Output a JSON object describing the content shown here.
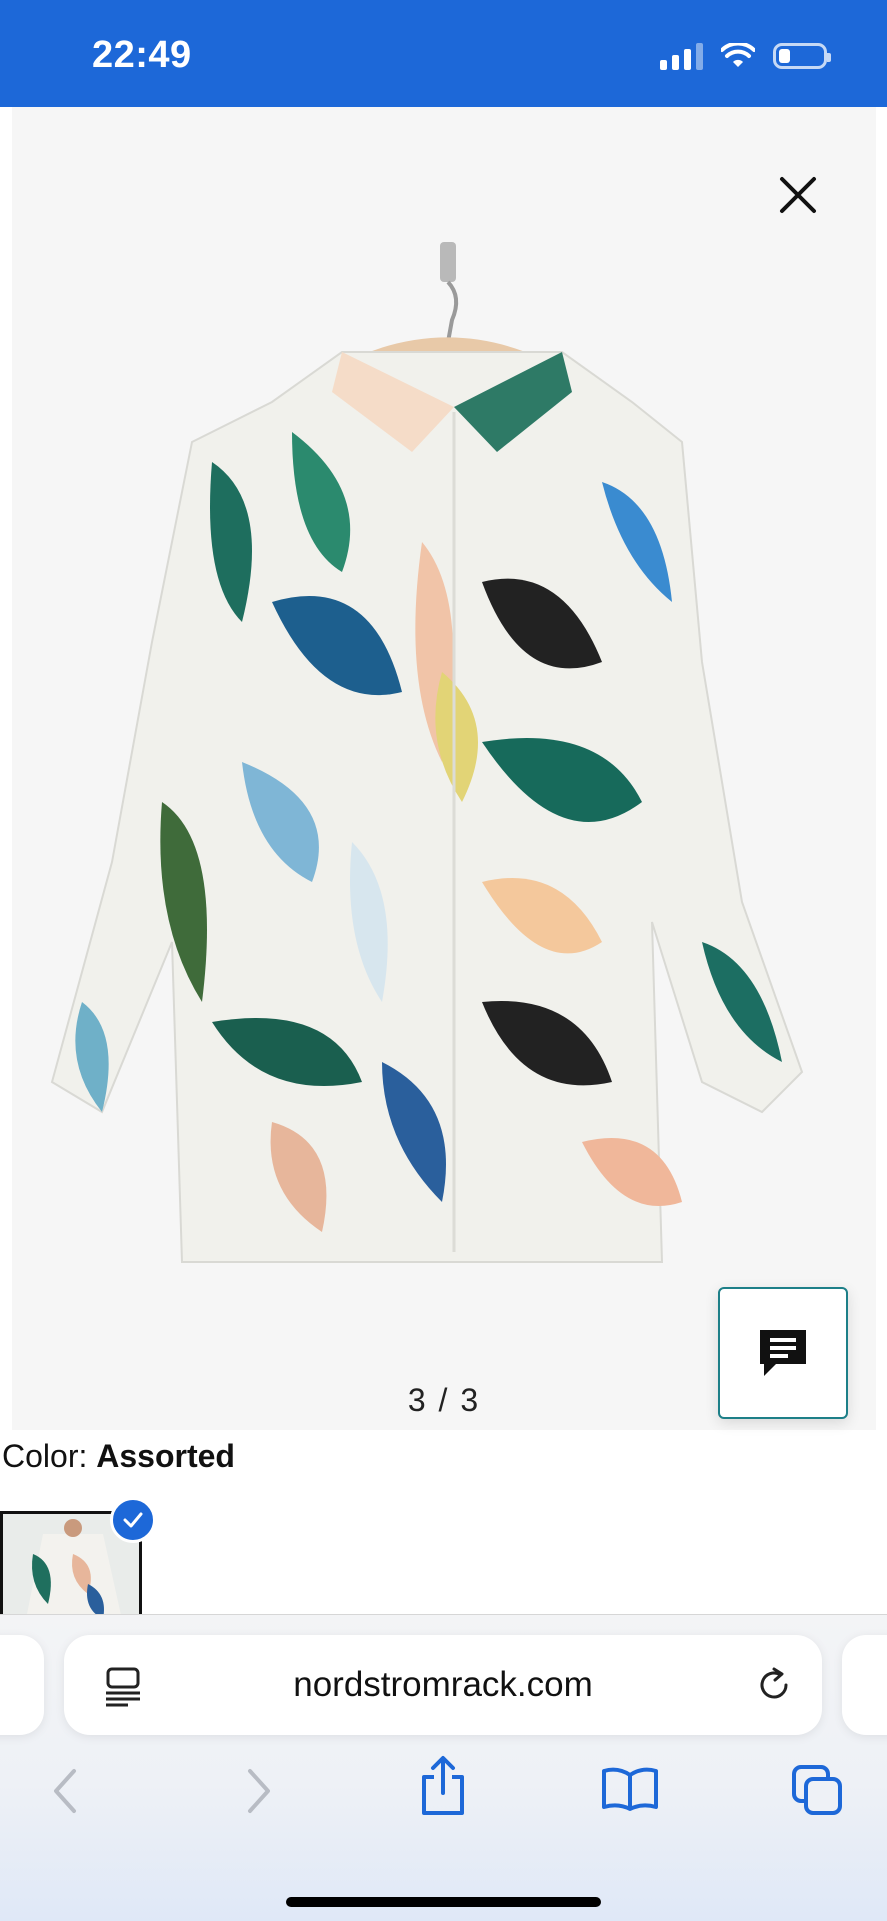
{
  "status_bar": {
    "time": "22:49",
    "battery_level": 0.25
  },
  "gallery": {
    "counter": "3 / 3"
  },
  "product": {
    "color_label": "Color:",
    "color_value": "Assorted"
  },
  "browser": {
    "url": "nordstromrack.com"
  },
  "colors": {
    "status_bar_bg": "#1d68d8",
    "accent": "#1d68d8",
    "chat_border": "#1d7f88"
  },
  "icons": [
    "close-icon",
    "chat-icon",
    "checkmark-icon",
    "reader-icon",
    "reload-icon",
    "back-icon",
    "forward-icon",
    "share-icon",
    "bookmarks-icon",
    "tabs-icon"
  ]
}
